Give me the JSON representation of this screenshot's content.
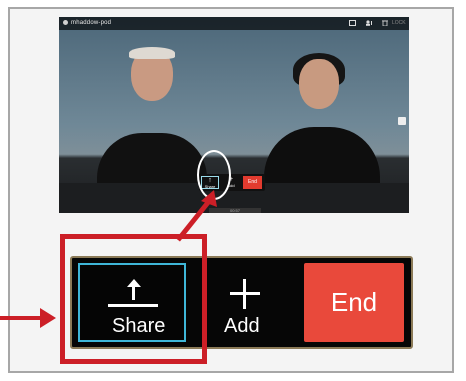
{
  "call": {
    "title": "mhaddow-pod",
    "lock_text": "LOCK",
    "mini_share": "Share",
    "mini_add": "Add",
    "mini_end": "End",
    "status_strip": "00:57"
  },
  "toolbar": {
    "share_label": "Share",
    "add_label": "Add",
    "end_label": "End"
  },
  "icons": {
    "share": "share-upload-icon",
    "add": "plus-icon",
    "end": "end-call"
  },
  "colors": {
    "highlight": "#cc1f27",
    "end_button": "#e9493b",
    "share_border": "#3fb6d8"
  }
}
